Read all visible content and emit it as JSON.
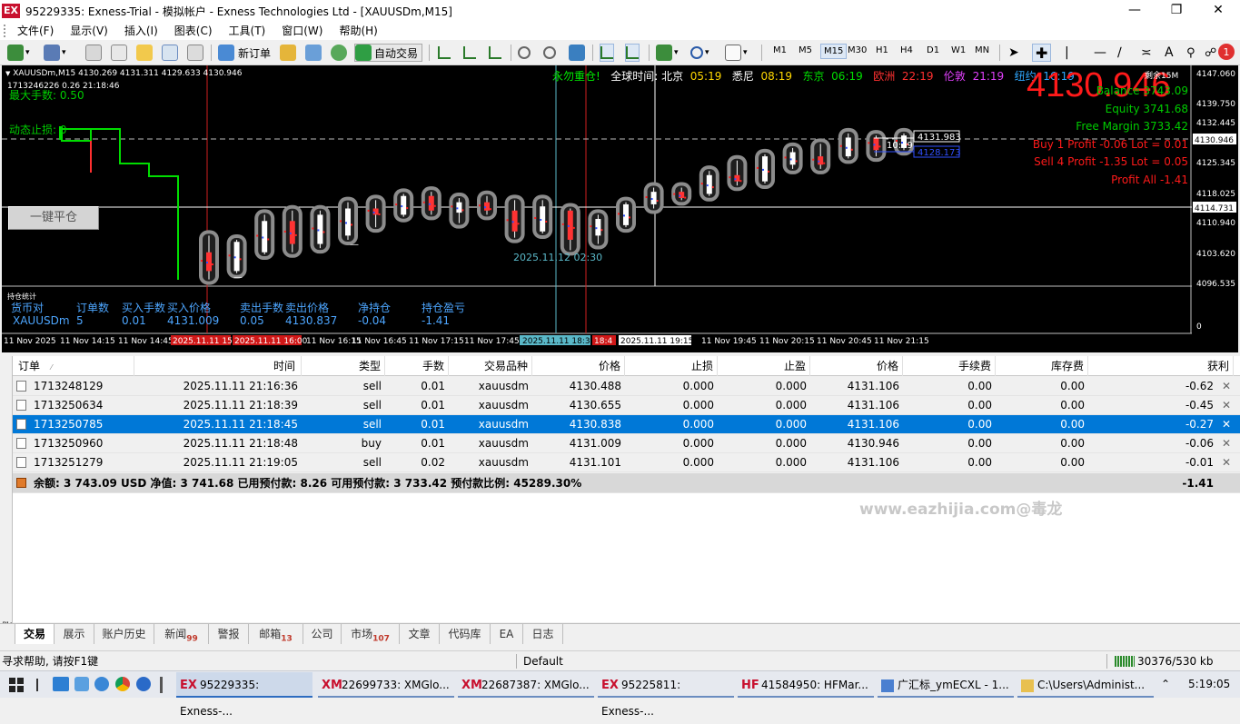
{
  "window": {
    "title": "95229335: Exness-Trial - 模拟帐户 - Exness Technologies Ltd - [XAUUSDm,M15]",
    "logo": "EX",
    "controls": [
      "minimize-icon",
      "restore-icon",
      "close-icon"
    ]
  },
  "menu": [
    "文件(F)",
    "显示(V)",
    "插入(I)",
    "图表(C)",
    "工具(T)",
    "窗口(W)",
    "帮助(H)"
  ],
  "toolbar": {
    "new_order": "新订单",
    "auto_trade": "自动交易",
    "timeframes": [
      "M1",
      "M5",
      "M15",
      "M30",
      "H1",
      "H4",
      "D1",
      "W1",
      "MN"
    ],
    "selected_timeframe": "M15",
    "notification_count": "1"
  },
  "chart": {
    "symbol_line": "XAUUSDm,M15  4130.269 4131.311 4129.633 4130.946",
    "ea_line": "1713246226 0.26     21:18:46",
    "max_lots": "最大手数: 0.50",
    "dynamic_sl": "动态止损: 0",
    "close_all_button": "一键平仓",
    "banner": {
      "warning": "永勿重仓!",
      "global_time": "全球时间: 北京",
      "beijing": "05:19",
      "sydney_label": "悉尼",
      "sydney": "08:19",
      "tokyo_label": "东京",
      "tokyo": "06:19",
      "europe_label": "欧洲",
      "europe": "22:19",
      "london_label": "伦敦",
      "london": "21:19",
      "newyork_label": "纽约",
      "newyork": "16:19"
    },
    "big_price": "4130.946",
    "spread_label": "剩余15M",
    "account": {
      "balance": "Balance 3743.09",
      "equity": "Equity 3741.68",
      "free_margin": "Free Margin 3733.42",
      "buy_line": "Buy 1   Profit -0.06  Lot = 0.01",
      "sell_line": "Sell 4   Profit -1.35  Lot = 0.05",
      "profit_all": "Profit All -1.41"
    },
    "price_axis": [
      "4147.060",
      "4139.750",
      "4132.445",
      "4125.345",
      "4118.025",
      "4110.940",
      "4103.620",
      "4096.535",
      "0"
    ],
    "price_tags": {
      "current": "4130.946",
      "crosshair": "4114.731",
      "level_up": "4131.983",
      "level_down": "4128.173",
      "clock": "10:49"
    },
    "crosshair_label": "2025.11.12 02:30",
    "time_axis": [
      "11 Nov 2025",
      "11 Nov 14:15",
      "11 Nov 14:45",
      "2025.11.11 15:",
      "2025.11.11 16:00",
      "11 Nov 16:15",
      "11 Nov 16:45",
      "11 Nov 17:15",
      "11 Nov 17:45",
      "2025.11.11 18:30",
      "18:4",
      "2025.11.11 19:15",
      "11 Nov 19:45",
      "11 Nov 20:15",
      "11 Nov 20:45",
      "11 Nov 21:15"
    ],
    "stats": {
      "title": "持仓统计",
      "headers": [
        "货币对",
        "订单数",
        "买入手数",
        "买入价格",
        "卖出手数",
        "卖出价格",
        "净持仓",
        "持仓盈亏"
      ],
      "values": [
        "XAUUSDm",
        "5",
        "0.01",
        "4131.009",
        "0.05",
        "4130.837",
        "-0.04",
        "-1.41"
      ]
    },
    "candles": [
      {
        "o": 4104.0,
        "h": 4108.0,
        "l": 4097.5,
        "c": 4099.5
      },
      {
        "o": 4099.5,
        "h": 4107.0,
        "l": 4099.0,
        "c": 4106.5
      },
      {
        "o": 4104.0,
        "h": 4113.0,
        "l": 4103.5,
        "c": 4111.5
      },
      {
        "o": 4111.5,
        "h": 4114.0,
        "l": 4104.0,
        "c": 4106.0
      },
      {
        "o": 4106.0,
        "h": 4114.0,
        "l": 4105.0,
        "c": 4113.0
      },
      {
        "o": 4108.0,
        "h": 4116.0,
        "l": 4107.0,
        "c": 4114.5
      },
      {
        "o": 4114.5,
        "h": 4116.5,
        "l": 4110.0,
        "c": 4113.0
      },
      {
        "o": 4113.0,
        "h": 4118.0,
        "l": 4112.5,
        "c": 4117.5
      },
      {
        "o": 4117.5,
        "h": 4118.5,
        "l": 4113.0,
        "c": 4114.0
      },
      {
        "o": 4113.5,
        "h": 4117.0,
        "l": 4111.0,
        "c": 4116.0
      },
      {
        "o": 4116.0,
        "h": 4117.5,
        "l": 4113.0,
        "c": 4114.0
      },
      {
        "o": 4114.0,
        "h": 4116.5,
        "l": 4107.5,
        "c": 4109.0
      },
      {
        "o": 4109.0,
        "h": 4116.5,
        "l": 4108.5,
        "c": 4115.0
      },
      {
        "o": 4114.0,
        "h": 4114.5,
        "l": 4104.5,
        "c": 4107.0
      },
      {
        "o": 4108.0,
        "h": 4113.0,
        "l": 4106.0,
        "c": 4112.0
      },
      {
        "o": 4110.5,
        "h": 4116.0,
        "l": 4110.0,
        "c": 4115.5
      },
      {
        "o": 4115.5,
        "h": 4119.5,
        "l": 4114.5,
        "c": 4118.5
      },
      {
        "o": 4118.5,
        "h": 4119.5,
        "l": 4116.5,
        "c": 4117.0
      },
      {
        "o": 4118.0,
        "h": 4123.5,
        "l": 4117.5,
        "c": 4122.5
      },
      {
        "o": 4122.5,
        "h": 4126.0,
        "l": 4120.0,
        "c": 4121.0
      },
      {
        "o": 4121.0,
        "h": 4127.5,
        "l": 4120.5,
        "c": 4127.0
      },
      {
        "o": 4125.0,
        "h": 4129.0,
        "l": 4124.0,
        "c": 4128.0
      },
      {
        "o": 4127.0,
        "h": 4130.0,
        "l": 4124.0,
        "c": 4125.0
      },
      {
        "o": 4127.0,
        "h": 4132.5,
        "l": 4126.5,
        "c": 4131.5
      },
      {
        "o": 4131.5,
        "h": 4132.0,
        "l": 4127.0,
        "c": 4128.5
      },
      {
        "o": 4129.0,
        "h": 4132.5,
        "l": 4128.5,
        "c": 4132.0
      }
    ]
  },
  "trades": {
    "columns": [
      "订单",
      "时间",
      "类型",
      "手数",
      "交易品种",
      "价格",
      "止损",
      "止盈",
      "价格",
      "手续费",
      "库存费",
      "获利"
    ],
    "rows": [
      {
        "order": "1713248129",
        "time": "2025.11.11 21:16:36",
        "type": "sell",
        "lots": "0.01",
        "symbol": "xauusdm",
        "price": "4130.488",
        "sl": "0.000",
        "tp": "0.000",
        "cur": "4131.106",
        "comm": "0.00",
        "swap": "0.00",
        "profit": "-0.62"
      },
      {
        "order": "1713250634",
        "time": "2025.11.11 21:18:39",
        "type": "sell",
        "lots": "0.01",
        "symbol": "xauusdm",
        "price": "4130.655",
        "sl": "0.000",
        "tp": "0.000",
        "cur": "4131.106",
        "comm": "0.00",
        "swap": "0.00",
        "profit": "-0.45"
      },
      {
        "order": "1713250785",
        "time": "2025.11.11 21:18:45",
        "type": "sell",
        "lots": "0.01",
        "symbol": "xauusdm",
        "price": "4130.838",
        "sl": "0.000",
        "tp": "0.000",
        "cur": "4131.106",
        "comm": "0.00",
        "swap": "0.00",
        "profit": "-0.27"
      },
      {
        "order": "1713250960",
        "time": "2025.11.11 21:18:48",
        "type": "buy",
        "lots": "0.01",
        "symbol": "xauusdm",
        "price": "4131.009",
        "sl": "0.000",
        "tp": "0.000",
        "cur": "4130.946",
        "comm": "0.00",
        "swap": "0.00",
        "profit": "-0.06"
      },
      {
        "order": "1713251279",
        "time": "2025.11.11 21:19:05",
        "type": "sell",
        "lots": "0.02",
        "symbol": "xauusdm",
        "price": "4131.101",
        "sl": "0.000",
        "tp": "0.000",
        "cur": "4131.106",
        "comm": "0.00",
        "swap": "0.00",
        "profit": "-0.01"
      }
    ],
    "selected_row": 2,
    "summary": "余额: 3 743.09 USD  净值: 3 741.68  已用预付款: 8.26  可用预付款: 3 733.42  预付款比例: 45289.30%",
    "summary_total": "-1.41"
  },
  "watermark": "www.eazhijia.com@毒龙",
  "tabs": [
    {
      "label": "交易",
      "badge": ""
    },
    {
      "label": "展示",
      "badge": ""
    },
    {
      "label": "账户历史",
      "badge": ""
    },
    {
      "label": "新闻",
      "badge": "99"
    },
    {
      "label": "警报",
      "badge": ""
    },
    {
      "label": "邮箱",
      "badge": "13"
    },
    {
      "label": "公司",
      "badge": ""
    },
    {
      "label": "市场",
      "badge": "107"
    },
    {
      "label": "文章",
      "badge": ""
    },
    {
      "label": "代码库",
      "badge": ""
    },
    {
      "label": "EA",
      "badge": ""
    },
    {
      "label": "日志",
      "badge": ""
    }
  ],
  "terminal_label": "终端",
  "status": {
    "help": "寻求帮助, 请按F1键",
    "profile": "Default",
    "traffic": "30376/530 kb"
  },
  "taskbar": {
    "items": [
      {
        "logo": "EX",
        "label": "95229335: Exness-..."
      },
      {
        "logo": "XM",
        "label": "22699733: XMGlo..."
      },
      {
        "logo": "XM",
        "label": "22687387: XMGlo..."
      },
      {
        "logo": "EX",
        "label": "95225811: Exness-..."
      },
      {
        "logo": "HF",
        "label": "41584950: HFMar..."
      },
      {
        "logo": "",
        "label": "广汇标_ymECXL - 1..."
      },
      {
        "logo": "",
        "label": "C:\\Users\\Administ..."
      }
    ],
    "clock": "5:19:05"
  },
  "colors": {
    "bull": "#ffffff",
    "bear": "#ff3333",
    "halo": "#8c8c8c",
    "green": "#00dd00",
    "red_price": "#ff1a1a",
    "select_row": "#0078d7"
  }
}
